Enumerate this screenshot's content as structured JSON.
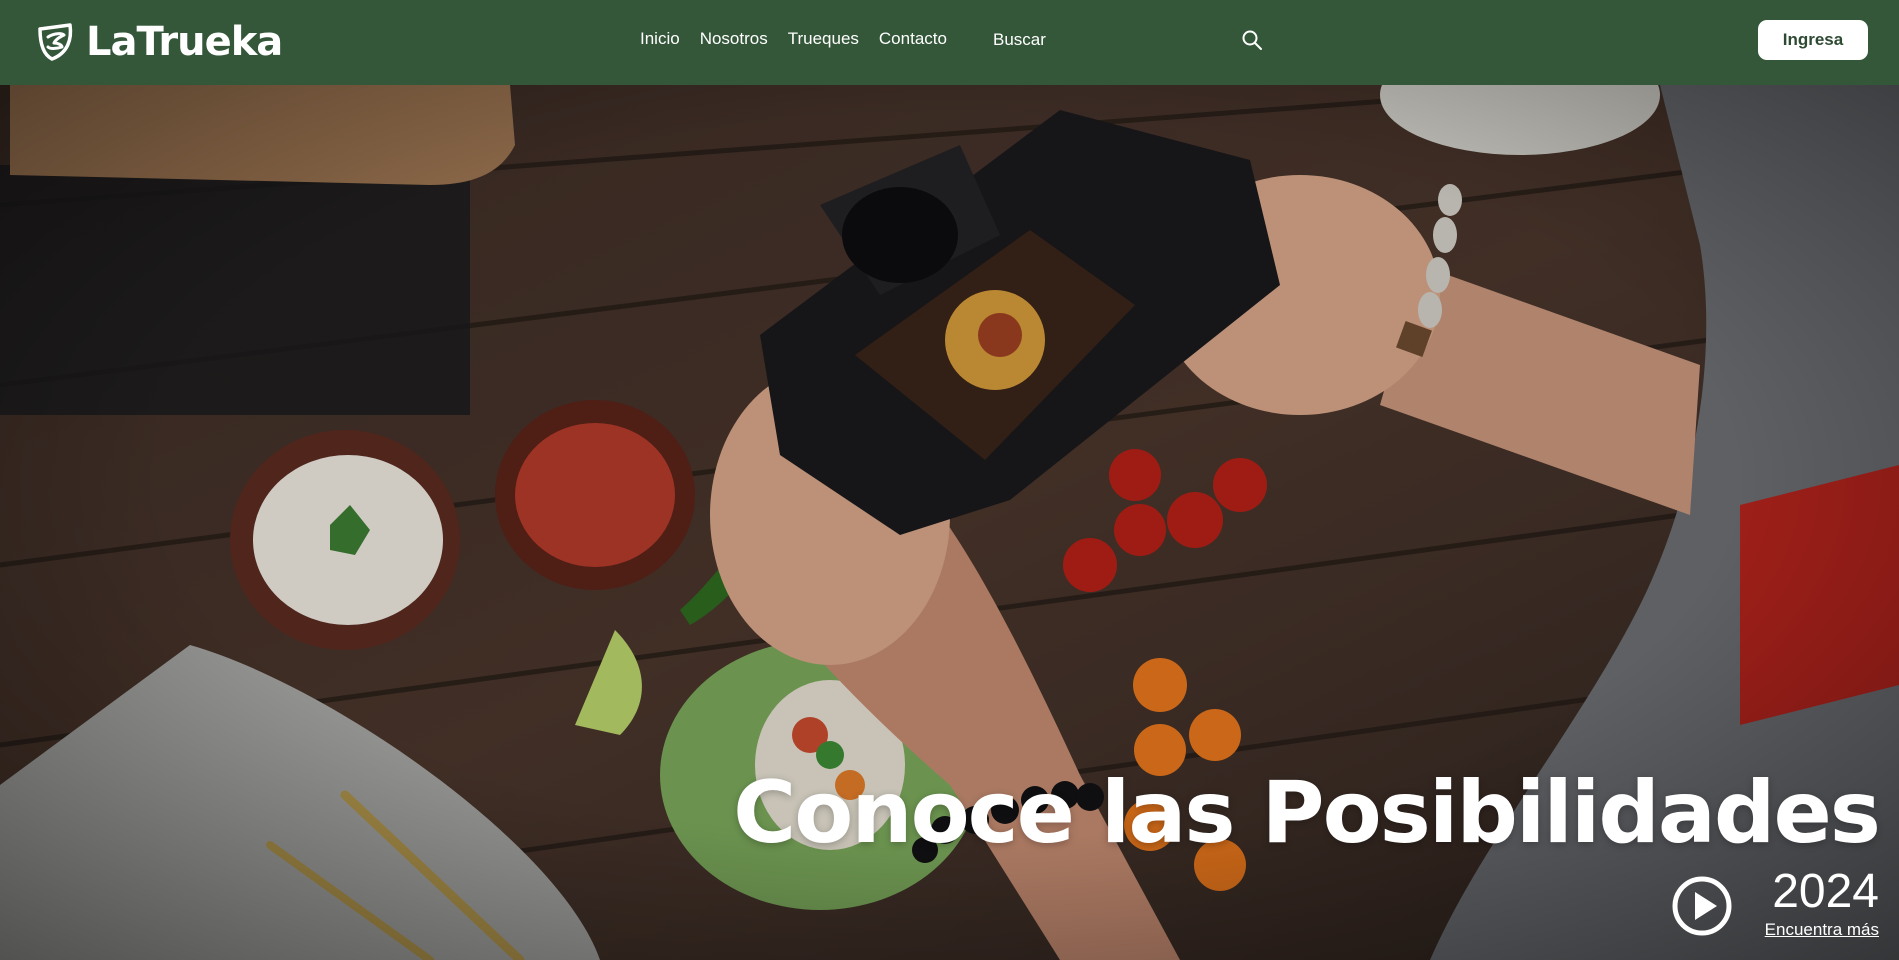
{
  "brand": {
    "name": "LaTrueka",
    "logo_icon": "leaf-shield-icon"
  },
  "nav": {
    "links": [
      {
        "label": "Inicio"
      },
      {
        "label": "Nosotros"
      },
      {
        "label": "Trueques"
      },
      {
        "label": "Contacto"
      }
    ],
    "search_placeholder": "Buscar",
    "search_icon": "search-icon",
    "login_label": "Ingresa"
  },
  "hero": {
    "image": "photographer-food-table-photo",
    "title": "Conoce las Posibilidades",
    "year": "2024",
    "link_label": "Encuentra más",
    "play_icon": "play-circle-icon"
  },
  "colors": {
    "navbar": "#34573a",
    "button_bg": "#ffffff",
    "button_text": "#2f4a33",
    "text": "#ffffff"
  }
}
